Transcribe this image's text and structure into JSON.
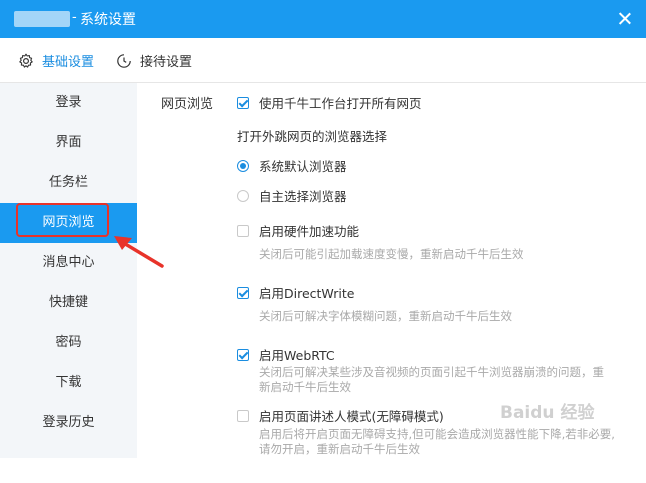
{
  "window": {
    "title": "系统设置",
    "separator": "-"
  },
  "tabs": [
    {
      "label": "基础设置",
      "icon": "gear-icon",
      "active": true
    },
    {
      "label": "接待设置",
      "icon": "clock-icon",
      "active": false
    }
  ],
  "sidebar": {
    "items": [
      {
        "label": "登录"
      },
      {
        "label": "界面"
      },
      {
        "label": "任务栏"
      },
      {
        "label": "网页浏览",
        "active": true
      },
      {
        "label": "消息中心"
      },
      {
        "label": "快捷键"
      },
      {
        "label": "密码"
      },
      {
        "label": "下载"
      },
      {
        "label": "登录历史"
      },
      {
        "label": ""
      }
    ]
  },
  "main": {
    "section_label": "网页浏览",
    "option_use_qianniu": {
      "label": "使用千牛工作台打开所有网页",
      "checked": true
    },
    "external_browser_label": "打开外跳网页的浏览器选择",
    "radio_default": {
      "label": "系统默认浏览器",
      "selected": true
    },
    "radio_custom": {
      "label": "自主选择浏览器",
      "selected": false
    },
    "option_hw_accel": {
      "label": "启用硬件加速功能",
      "checked": false,
      "desc": "关闭后可能引起加载速度变慢，重新启动千牛后生效"
    },
    "option_directwrite": {
      "label": "启用DirectWrite",
      "checked": true,
      "desc": "关闭后可解决字体模糊问题，重新启动千牛后生效"
    },
    "option_webrtc": {
      "label": "启用WebRTC",
      "checked": true,
      "desc_line1": "关闭后可解决某些涉及音视频的页面引起千牛浏览器崩溃的问题，重",
      "desc_line2": "新启动千牛后生效"
    },
    "option_narrator": {
      "label": "启用页面讲述人模式(无障碍模式)",
      "checked": false,
      "desc_line1": "启用后将开启页面无障碍支持,但可能会造成浏览器性能下降,若非必要,",
      "desc_line2": "请勿开启，重新启动千牛后生效"
    }
  },
  "watermark": "Baidu 经验",
  "colors": {
    "titlebar": "#1a9af0",
    "accent": "#1a8de0",
    "highlight": "#e8332a",
    "sidebar_bg": "#f3f6f9"
  }
}
